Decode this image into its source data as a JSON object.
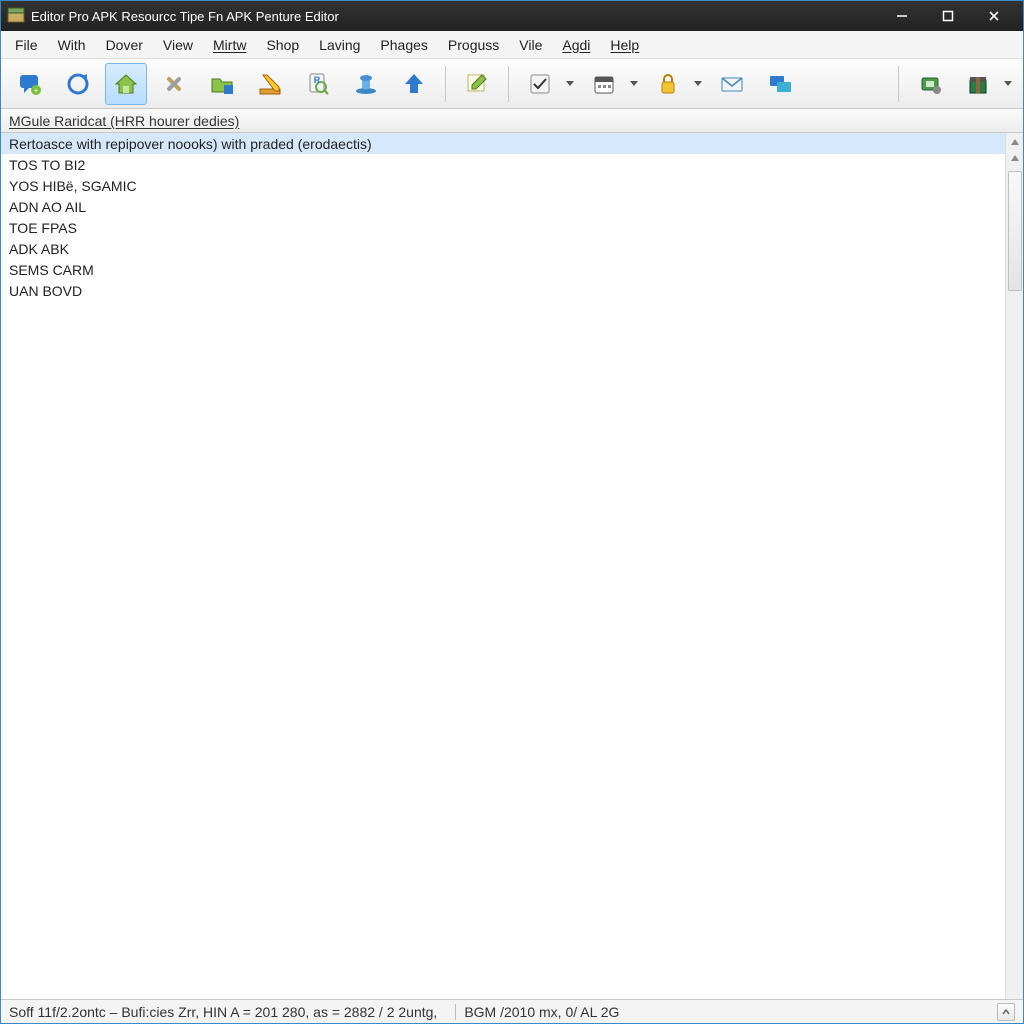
{
  "window": {
    "title": "Editor Pro APK Resourcc Tipe Fn APK Penture Editor"
  },
  "menus": [
    {
      "label": "File",
      "underline": false
    },
    {
      "label": "With",
      "underline": false
    },
    {
      "label": "Dover",
      "underline": false
    },
    {
      "label": "View",
      "underline": false
    },
    {
      "label": "Mirtw",
      "underline": true
    },
    {
      "label": "Shop",
      "underline": false
    },
    {
      "label": "Laving",
      "underline": false
    },
    {
      "label": "Phages",
      "underline": false
    },
    {
      "label": "Proguss",
      "underline": false
    },
    {
      "label": "Vile",
      "underline": false
    },
    {
      "label": "Agdi",
      "underline": true
    },
    {
      "label": "Help",
      "underline": true
    }
  ],
  "header": {
    "text": "MGule Raridcat (HRR hourer dedies)"
  },
  "list": {
    "items": [
      "Rertoasce with repipover noooks) with praded (erodaectis)",
      "TOS TO BI2",
      "YOS HIBë, SGAMIC",
      "ADN AO AIL",
      "TOE FPAS",
      "ADK ABK",
      "SEMS CARM",
      "UAN BOVD"
    ],
    "selected_index": 0
  },
  "statusbar": {
    "left": "Soff 11f/2.2ontc – Bufi:cies Zrr, HIN A = 201 280, as = 2882 / 2 2untg,",
    "right": "BGM /2010 mx, 0/ AL 2G"
  },
  "toolbar": {
    "icons": [
      "chat-bubble-icon",
      "refresh-icon",
      "house-icon",
      "tools-cross-icon",
      "folder-open-icon",
      "pencil-ruler-icon",
      "search-doc-icon",
      "stamps-icon",
      "arrow-up-icon",
      "edit-pen-icon",
      "checkbox-icon",
      "calendar-icon",
      "lock-icon",
      "mail-icon",
      "screens-icon",
      "chip-icon",
      "package-icon"
    ]
  }
}
